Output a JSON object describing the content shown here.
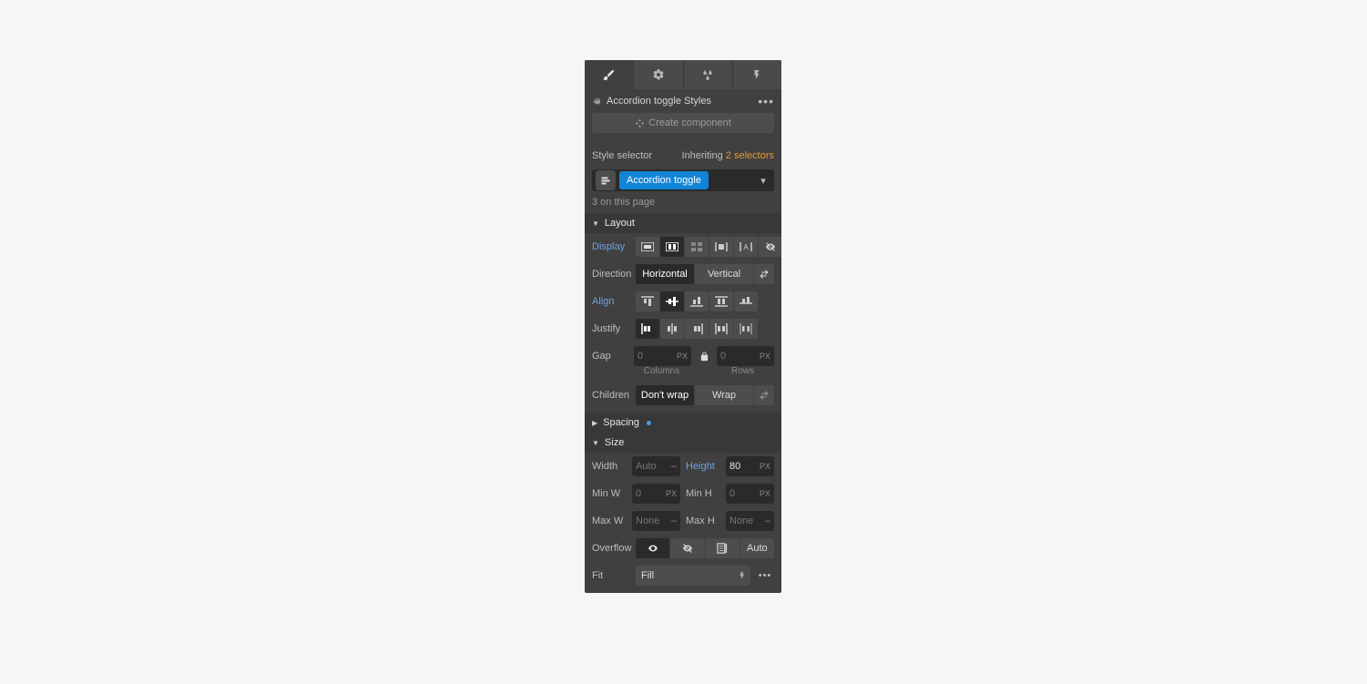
{
  "header": {
    "element_label": "Accordion toggle Styles",
    "create_component": "Create component"
  },
  "selector": {
    "label": "Style selector",
    "inheriting_text": "Inheriting",
    "inheriting_count": "2 selectors",
    "chip": "Accordion toggle",
    "page_count": "3 on this page"
  },
  "layout": {
    "title": "Layout",
    "display_label": "Display",
    "direction_label": "Direction",
    "direction_horizontal": "Horizontal",
    "direction_vertical": "Vertical",
    "align_label": "Align",
    "justify_label": "Justify",
    "gap_label": "Gap",
    "gap_col_placeholder": "0",
    "gap_col_unit": "PX",
    "gap_row_placeholder": "0",
    "gap_row_unit": "PX",
    "gap_col_title": "Columns",
    "gap_row_title": "Rows",
    "children_label": "Children",
    "children_nowrap": "Don't wrap",
    "children_wrap": "Wrap"
  },
  "spacing": {
    "title": "Spacing"
  },
  "size": {
    "title": "Size",
    "width_label": "Width",
    "width_placeholder": "Auto",
    "width_unit": "–",
    "height_label": "Height",
    "height_value": "80",
    "height_unit": "PX",
    "minw_label": "Min W",
    "minw_placeholder": "0",
    "minw_unit": "PX",
    "minh_label": "Min H",
    "minh_placeholder": "0",
    "minh_unit": "PX",
    "maxw_label": "Max W",
    "maxw_placeholder": "None",
    "maxw_unit": "–",
    "maxh_label": "Max H",
    "maxh_placeholder": "None",
    "maxh_unit": "–",
    "overflow_label": "Overflow",
    "overflow_auto": "Auto",
    "fit_label": "Fit",
    "fit_value": "Fill"
  }
}
